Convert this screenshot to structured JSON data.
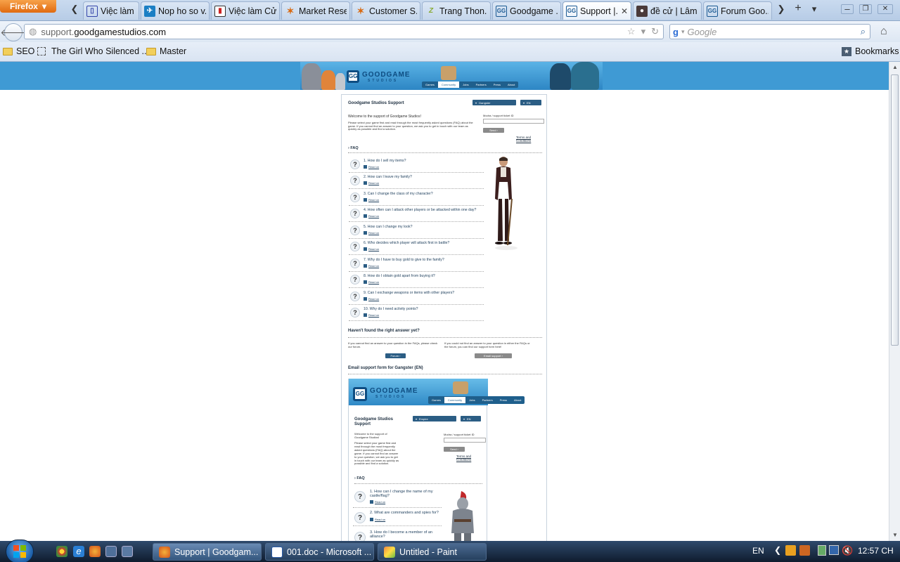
{
  "browser": {
    "menu_button": "Firefox",
    "tabs": [
      {
        "title": "Việc làm Ac...",
        "favicon": "vietnamworks-icon"
      },
      {
        "title": "Nop ho so v...",
        "favicon": "plane-icon"
      },
      {
        "title": "Việc làm Cử...",
        "favicon": "doc-icon"
      },
      {
        "title": "Market Rese...",
        "favicon": "star-icon"
      },
      {
        "title": "Customer S...",
        "favicon": "star-icon"
      },
      {
        "title": "Trang Thon...",
        "favicon": "zing-icon"
      },
      {
        "title": "Goodgame ...",
        "favicon": "gg-icon"
      },
      {
        "title": "Support |...",
        "favicon": "gg-icon",
        "active": true
      },
      {
        "title": "đề cử | Lâm ...",
        "favicon": "avatar-icon"
      },
      {
        "title": "Forum Goo...",
        "favicon": "gg-icon"
      }
    ],
    "url_prefix": "support.",
    "url_host": "goodgamestudios.com",
    "search_placeholder": "Google",
    "bookmarks": [
      "SEO",
      "The Girl Who Silenced ...",
      "Master"
    ],
    "bookmarks_menu": "Bookmarks"
  },
  "page": {
    "brand": "GOODGAME",
    "brand_sub": "STUDIOS",
    "nav": [
      "Games",
      "Community",
      "Jobs",
      "Partners",
      "Press",
      "About"
    ],
    "title": "Goodgame Studios Support",
    "game_select": "Gangster",
    "lang_select": "EN",
    "welcome": "Welcome to the support of Goodgame Studios!",
    "intro": "Please select your game first and read through the most frequently asked questions (FAQ) about the game. If you cannot find an answer to your question, we ask you to get in touch with our team as quickly as possible and find a solution.",
    "ticket_label": "Modra / support ticket ID",
    "send": "Send",
    "terms": "Terms and Conditions",
    "faq_heading": "FAQ",
    "read_label": "Read on",
    "faqs": [
      "1. How do I sell my items?",
      "2. How can I leave my family?",
      "3. Can I change the class of my character?",
      "4. How often can I attack other players or be attacked within one day?",
      "5. How can I change my look?",
      "6. Who decides which player will attack first in battle?",
      "7. Why do I have to buy gold to give to the family?",
      "8. How do I obtain gold apart from buying it?",
      "9. Can I exchange weapons or items with other players?",
      "10. Why do I need activity points?"
    ],
    "not_found_heading": "Haven't found the right answer yet?",
    "forum_text": "If you cannot find an answer to your question in the FAQs, please check our forum.",
    "forum_btn": "Forum",
    "email_text": "If you could not find an answer to your question in either the FAQs or the forum, you can find our support form here!",
    "email_btn": "Email support",
    "email_form_heading": "Email support form for Gangster (EN)",
    "inner": {
      "title": "Goodgame Studios Support",
      "game_select": "Empire",
      "lang_select": "EN",
      "welcome": "Welcome to the support of Goodgame Studios!",
      "intro": "Please select your game first and read through the most frequently asked questions (FAQ) about the game. If you cannot find an answer to your question, we ask you to get in touch with our team as quickly as possible and find a solution.",
      "ticket_label": "Modra / support ticket ID",
      "send": "Send",
      "terms": "Terms and Conditions",
      "faq_heading": "FAQ",
      "faqs": [
        "1. How can I change the name of my castle/flag?",
        "2. What are commanders and spies for?",
        "3. How do I become a member of an alliance?"
      ]
    }
  },
  "taskbar": {
    "tasks": [
      {
        "title": "Support | Goodgam...",
        "icon": "firefox-icon",
        "active": true
      },
      {
        "title": "001.doc - Microsoft ...",
        "icon": "word-icon"
      },
      {
        "title": "Untitled - Paint",
        "icon": "paint-icon"
      }
    ],
    "lang": "EN",
    "clock": "12:57 CH"
  },
  "colors": {
    "banner": "#3f9ad4",
    "nav_dark": "#2b5d84",
    "taskbar": "#1a2c45"
  }
}
